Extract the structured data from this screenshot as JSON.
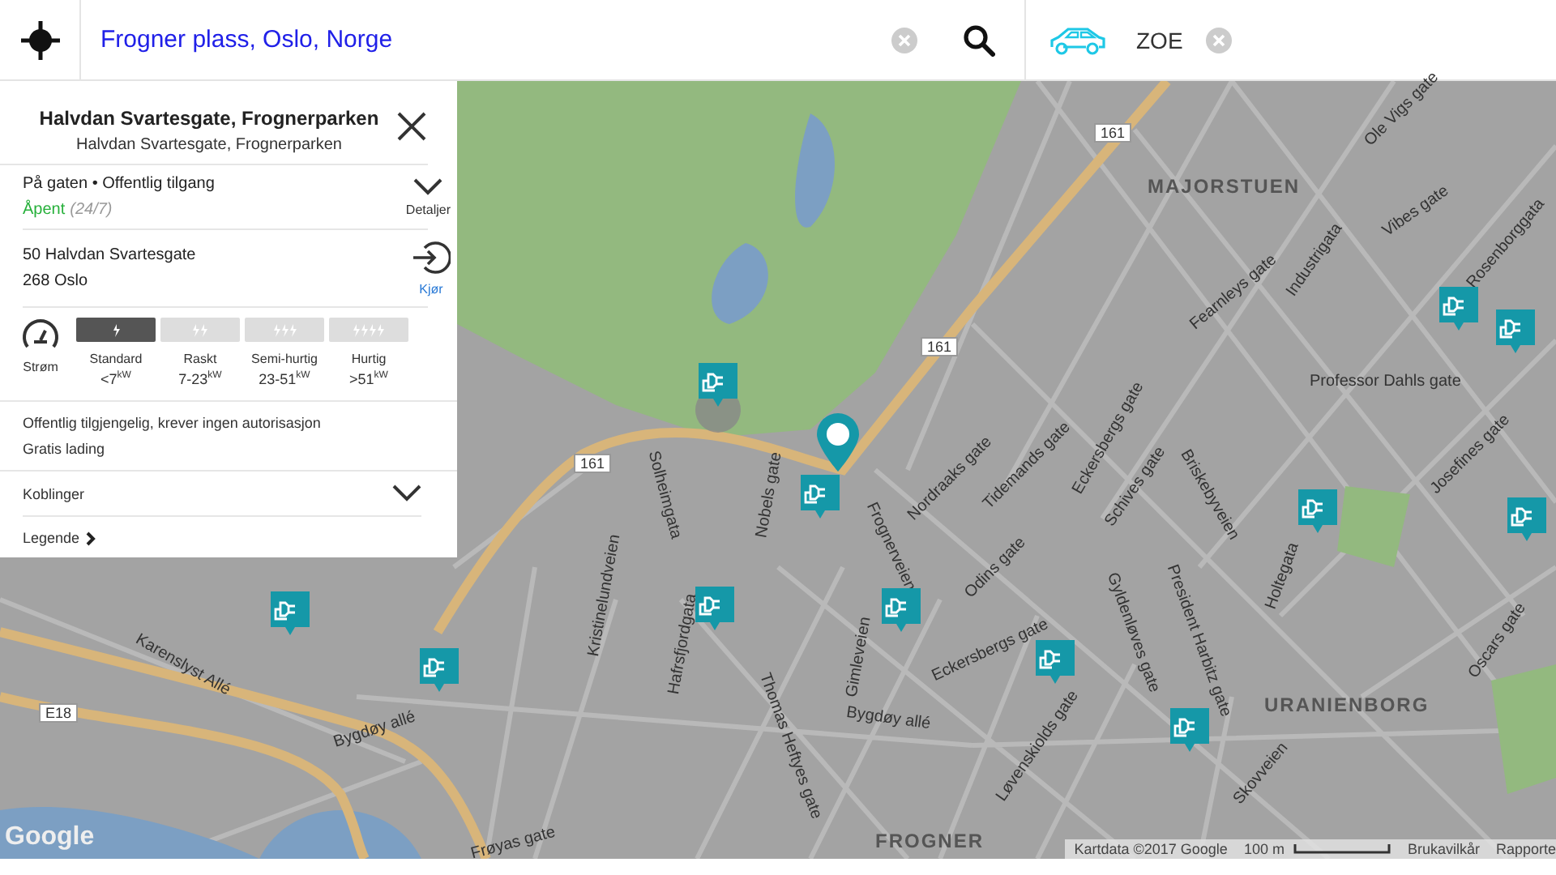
{
  "search": {
    "value": "Frogner plass, Oslo, Norge"
  },
  "vehicle": {
    "name": "ZOE"
  },
  "station": {
    "title": "Halvdan Svartesgate, Frognerparken",
    "subtitle": "Halvdan Svartesgate, Frognerparken",
    "type": "På gaten • Offentlig tilgang",
    "status": "Åpent",
    "open": true,
    "hours": "(24/7)",
    "details_label": "Detaljer",
    "address_line1": "50 Halvdan Svartesgate",
    "address_line2": "268 Oslo",
    "drive_label": "Kjør",
    "power_label": "Strøm",
    "speeds": [
      {
        "name": "Standard",
        "value": "<7",
        "unit": "kW",
        "selected": true
      },
      {
        "name": "Raskt",
        "value": "7-23",
        "unit": "kW",
        "selected": false
      },
      {
        "name": "Semi-hurtig",
        "value": "23-51",
        "unit": "kW",
        "selected": false
      },
      {
        "name": "Hurtig",
        "value": ">51",
        "unit": "kW",
        "selected": false
      }
    ],
    "access": "Offentlig tilgjengelig, krever ingen autorisasjon",
    "price": "Gratis lading",
    "connectors_label": "Koblinger",
    "legend_label": "Legende"
  },
  "map": {
    "area_labels": [
      "MAJORSTUEN",
      "URANIENBORG",
      "FROGNER"
    ],
    "street_labels": [
      "Professor Dahls gate",
      "Fearnleys gate",
      "Industrigata",
      "Tidemands gate",
      "Eckersbergs gate",
      "Nordraaks gate",
      "Odins gate",
      "Schives gate",
      "Briskebyveien",
      "Holtegata",
      "Josefines gate",
      "Oscars gate",
      "Gimleveien",
      "Frognerveien",
      "Nobels gate",
      "Solheimgata",
      "Kristinelundveien",
      "Hafrsfjordgata",
      "Thomas Heftyes gate",
      "Karenslyst Allé",
      "Bygdøy allé",
      "Bygdøy allé",
      "Skovveien",
      "Løvenskiolds gate",
      "President Harbitz gate",
      "Gyldenløves gate",
      "Eckersbergs gate",
      "Frøyas gate",
      "Ole Vigs gate",
      "Vibes gate",
      "Rosenborggata"
    ],
    "road_numbers": [
      "161",
      "161",
      "161",
      "E18"
    ],
    "logo": "Google",
    "attribution": "Kartdata ©2017 Google",
    "scale": "100 m",
    "terms": "Brukavilkår",
    "report": "Rapporte"
  }
}
